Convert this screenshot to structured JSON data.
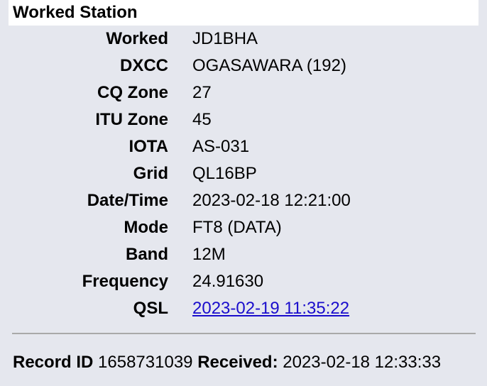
{
  "header": {
    "title": "Worked Station"
  },
  "fields": [
    {
      "label": "Worked",
      "value": "JD1BHA"
    },
    {
      "label": "DXCC",
      "value": "OGASAWARA (192)"
    },
    {
      "label": "CQ Zone",
      "value": "27"
    },
    {
      "label": "ITU Zone",
      "value": "45"
    },
    {
      "label": "IOTA",
      "value": "AS-031"
    },
    {
      "label": "Grid",
      "value": "QL16BP"
    },
    {
      "label": "Date/Time",
      "value": "2023-02-18 12:21:00"
    },
    {
      "label": "Mode",
      "value": "FT8 (DATA)"
    },
    {
      "label": "Band",
      "value": "12M"
    },
    {
      "label": "Frequency",
      "value": "24.91630"
    },
    {
      "label": "QSL",
      "value": "2023-02-19 11:35:22"
    }
  ],
  "footer": {
    "record_id_label": "Record ID",
    "record_id_value": "1658731039",
    "received_label": "Received:",
    "received_value": "2023-02-18 12:33:33"
  },
  "colors": {
    "panel_background": "#e5e7ee",
    "link": "#1a0dcc",
    "divider": "#a9a9a9"
  }
}
